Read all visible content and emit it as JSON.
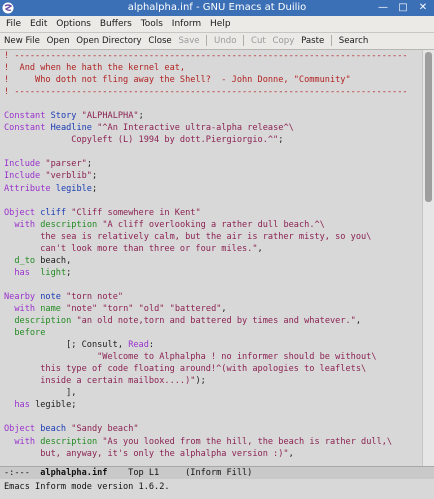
{
  "window": {
    "title": "alphalpha.inf - GNU Emacs at Duilio"
  },
  "menu": [
    "File",
    "Edit",
    "Options",
    "Buffers",
    "Tools",
    "Inform",
    "Help"
  ],
  "toolbar": {
    "new": "New File",
    "open": "Open",
    "open_dir": "Open Directory",
    "close": "Close",
    "save": "Save",
    "undo": "Undo",
    "cut": "Cut",
    "copy": "Copy",
    "paste": "Paste",
    "search": "Search"
  },
  "editor": {
    "lines": [
      [
        {
          "t": "! ----------------------------------------------------------------------------",
          "c": "cm"
        }
      ],
      [
        {
          "t": "!  And when he hath the kernel eat,",
          "c": "cm"
        }
      ],
      [
        {
          "t": "!     Who doth not fling away the Shell?  - John Donne, \"Community\"",
          "c": "cm"
        }
      ],
      [
        {
          "t": "! ----------------------------------------------------------------------------",
          "c": "cm"
        }
      ],
      [],
      [
        {
          "t": "Constant",
          "c": "kw"
        },
        {
          "t": " "
        },
        {
          "t": "Story",
          "c": "vn"
        },
        {
          "t": " "
        },
        {
          "t": "\"ALPHALPHA\"",
          "c": "st"
        },
        {
          "t": ";"
        }
      ],
      [
        {
          "t": "Constant",
          "c": "kw"
        },
        {
          "t": " "
        },
        {
          "t": "Headline",
          "c": "vn"
        },
        {
          "t": " "
        },
        {
          "t": "\"^An Interactive ultra-alpha release^\\",
          "c": "st"
        }
      ],
      [
        {
          "t": "             Copyleft (L) 1994 by dott.Piergiorgio.^\"",
          "c": "st"
        },
        {
          "t": ";"
        }
      ],
      [],
      [
        {
          "t": "Include",
          "c": "kw"
        },
        {
          "t": " "
        },
        {
          "t": "\"parser\"",
          "c": "st"
        },
        {
          "t": ";"
        }
      ],
      [
        {
          "t": "Include",
          "c": "kw"
        },
        {
          "t": " "
        },
        {
          "t": "\"verblib\"",
          "c": "st"
        },
        {
          "t": ";"
        }
      ],
      [
        {
          "t": "Attribute",
          "c": "kw"
        },
        {
          "t": " "
        },
        {
          "t": "legible",
          "c": "vn"
        },
        {
          "t": ";"
        }
      ],
      [],
      [
        {
          "t": "Object",
          "c": "kw"
        },
        {
          "t": " "
        },
        {
          "t": "cliff",
          "c": "vn"
        },
        {
          "t": " "
        },
        {
          "t": "\"Cliff somewhere in Kent\"",
          "c": "st"
        }
      ],
      [
        {
          "t": "  "
        },
        {
          "t": "with",
          "c": "kw"
        },
        {
          "t": " "
        },
        {
          "t": "description",
          "c": "ty"
        },
        {
          "t": " "
        },
        {
          "t": "\"A cliff overlooking a rather dull beach.^\\",
          "c": "st"
        }
      ],
      [
        {
          "t": "       the sea is relatively calm, but the air is rather misty, so you\\",
          "c": "st"
        }
      ],
      [
        {
          "t": "       can't look more than three or four miles.\"",
          "c": "st"
        },
        {
          "t": ","
        }
      ],
      [
        {
          "t": "  "
        },
        {
          "t": "d_to",
          "c": "ty"
        },
        {
          "t": " beach,"
        }
      ],
      [
        {
          "t": "  "
        },
        {
          "t": "has",
          "c": "kw"
        },
        {
          "t": "  "
        },
        {
          "t": "light",
          "c": "ty"
        },
        {
          "t": ";"
        }
      ],
      [],
      [
        {
          "t": "Nearby",
          "c": "kw"
        },
        {
          "t": " "
        },
        {
          "t": "note",
          "c": "vn"
        },
        {
          "t": " "
        },
        {
          "t": "\"torn note\"",
          "c": "st"
        }
      ],
      [
        {
          "t": "  "
        },
        {
          "t": "with",
          "c": "kw"
        },
        {
          "t": " "
        },
        {
          "t": "name",
          "c": "ty"
        },
        {
          "t": " "
        },
        {
          "t": "\"note\"",
          "c": "st"
        },
        {
          "t": " "
        },
        {
          "t": "\"torn\"",
          "c": "st"
        },
        {
          "t": " "
        },
        {
          "t": "\"old\"",
          "c": "st"
        },
        {
          "t": " "
        },
        {
          "t": "\"battered\"",
          "c": "st"
        },
        {
          "t": ","
        }
      ],
      [
        {
          "t": "  "
        },
        {
          "t": "description",
          "c": "ty"
        },
        {
          "t": " "
        },
        {
          "t": "\"an old note,torn and battered by times and whatever.\"",
          "c": "st"
        },
        {
          "t": ","
        }
      ],
      [
        {
          "t": "  "
        },
        {
          "t": "before",
          "c": "ty"
        }
      ],
      [
        {
          "t": "            [; Consult, "
        },
        {
          "t": "Read",
          "c": "ctl2"
        },
        {
          "t": ":"
        }
      ],
      [
        {
          "t": "                  \"Welcome to Alphalpha ! no informer should be without\\",
          "c": "st"
        }
      ],
      [
        {
          "t": "       this type of code floating around!^(with apologies to leaflets\\",
          "c": "st"
        }
      ],
      [
        {
          "t": "       inside a certain mailbox....)\"",
          "c": "st"
        },
        {
          "t": ");"
        }
      ],
      [
        {
          "t": "            ],"
        }
      ],
      [
        {
          "t": "  "
        },
        {
          "t": "has",
          "c": "kw"
        },
        {
          "t": " legible;"
        }
      ],
      [],
      [
        {
          "t": "Object",
          "c": "kw"
        },
        {
          "t": " "
        },
        {
          "t": "beach",
          "c": "vn"
        },
        {
          "t": " "
        },
        {
          "t": "\"Sandy beach\"",
          "c": "st"
        }
      ],
      [
        {
          "t": "  "
        },
        {
          "t": "with",
          "c": "kw"
        },
        {
          "t": " "
        },
        {
          "t": "description",
          "c": "ty"
        },
        {
          "t": " "
        },
        {
          "t": "\"As you looked from the hill, the beach is rather dull,\\",
          "c": "st"
        }
      ],
      [
        {
          "t": "       but, anyway, it's only the alphalpha version :)\"",
          "c": "st"
        },
        {
          "t": ","
        }
      ]
    ]
  },
  "modeline": {
    "prefix": "-:---  ",
    "buffer": "alphalpha.inf",
    "position": "    Top L1     ",
    "mode": "(Inform Fill)"
  },
  "echo": "Emacs Inform mode version 1.6.2."
}
